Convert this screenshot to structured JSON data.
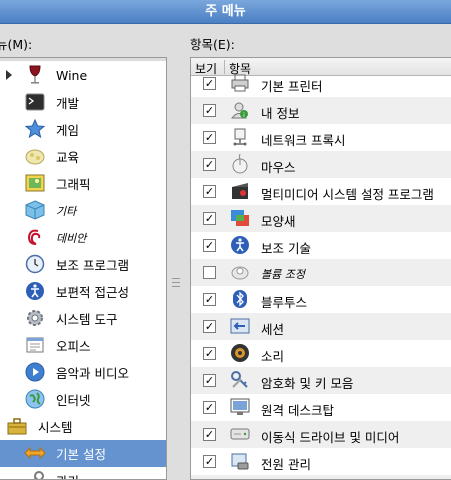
{
  "window": {
    "title": "주 메뉴"
  },
  "left_label": "뉴(M):",
  "right_label": "항목(E):",
  "columns": {
    "show": "보기",
    "item": "항목"
  },
  "left_items": [
    {
      "label": "Wine",
      "icon": "wine-glass-icon",
      "expander": true
    },
    {
      "label": "개발",
      "icon": "terminal-icon"
    },
    {
      "label": "게임",
      "icon": "star-icon"
    },
    {
      "label": "교육",
      "icon": "education-icon"
    },
    {
      "label": "그래픽",
      "icon": "picture-icon"
    },
    {
      "label": "기타",
      "icon": "cube-icon",
      "italic": true
    },
    {
      "label": "데비안",
      "icon": "debian-swirl-icon",
      "italic": true
    },
    {
      "label": "보조 프로그램",
      "icon": "clock-icon"
    },
    {
      "label": "보편적 접근성",
      "icon": "accessibility-icon"
    },
    {
      "label": "시스템 도구",
      "icon": "gear-icon"
    },
    {
      "label": "오피스",
      "icon": "office-icon"
    },
    {
      "label": "음악과 비디오",
      "icon": "play-icon"
    },
    {
      "label": "인터넷",
      "icon": "globe-icon"
    },
    {
      "label": "시스템",
      "icon": "toolbox-icon",
      "top_level": true
    },
    {
      "label": "기본 설정",
      "icon": "arrows-icon",
      "selected": true
    },
    {
      "label": "관리",
      "icon": "tools-icon"
    }
  ],
  "right_items": [
    {
      "label": "기본 프린터",
      "icon": "printer-icon",
      "checked": true
    },
    {
      "label": "내 정보",
      "icon": "about-me-icon",
      "checked": true
    },
    {
      "label": "네트워크 프록시",
      "icon": "proxy-icon",
      "checked": true
    },
    {
      "label": "마우스",
      "icon": "mouse-icon",
      "checked": true
    },
    {
      "label": "멀티미디어 시스템 설정 프로그램",
      "icon": "multimedia-icon",
      "checked": true
    },
    {
      "label": "모양새",
      "icon": "appearance-icon",
      "checked": true
    },
    {
      "label": "보조 기술",
      "icon": "accessibility-icon",
      "checked": true
    },
    {
      "label": "볼륨 조정",
      "icon": "volume-icon",
      "checked": false,
      "italic": true
    },
    {
      "label": "블루투스",
      "icon": "bluetooth-icon",
      "checked": true
    },
    {
      "label": "세션",
      "icon": "session-icon",
      "checked": true
    },
    {
      "label": "소리",
      "icon": "speaker-icon",
      "checked": true
    },
    {
      "label": "암호화 및 키 모음",
      "icon": "keys-icon",
      "checked": true
    },
    {
      "label": "원격 데스크탑",
      "icon": "remote-desktop-icon",
      "checked": true
    },
    {
      "label": "이동식 드라이브 및 미디어",
      "icon": "drive-icon",
      "checked": true
    },
    {
      "label": "전원 관리",
      "icon": "power-icon",
      "checked": true
    },
    {
      "label": "",
      "icon": "partial-icon",
      "checked": true
    }
  ]
}
